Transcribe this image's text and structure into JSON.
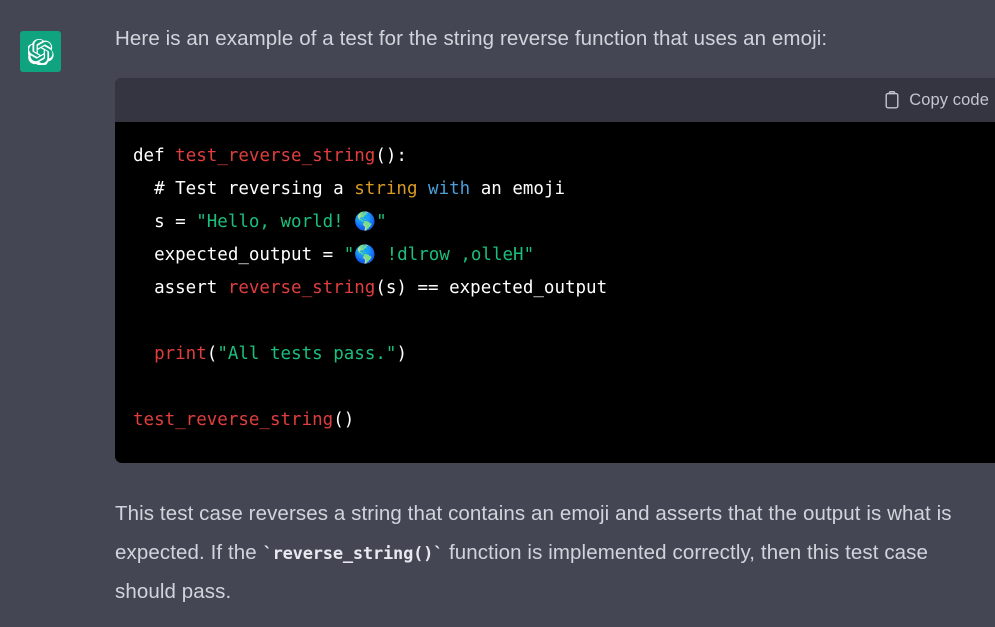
{
  "theme": {
    "page_background": "#444654",
    "avatar_background": "#10a37f",
    "code_header_background": "#343541",
    "code_body_background": "#000000",
    "text_color": "#d1d5db"
  },
  "avatar": {
    "icon": "openai-logo-icon",
    "alt": "ChatGPT"
  },
  "message": {
    "intro": "Here is an example of a test for the string reverse function that uses an emoji:",
    "outro_part1": "This test case reverses a string that contains an emoji and asserts that the output is what is expected. If the ",
    "outro_code": "`reverse_string()`",
    "outro_part2": " function is implemented correctly, then this test case should pass."
  },
  "code_block": {
    "language": "python",
    "copy_label": "Copy code",
    "copy_icon": "clipboard-icon",
    "lines": [
      {
        "id": "line-1",
        "tokens": [
          {
            "t": "def ",
            "c": "plain"
          },
          {
            "t": "test_reverse_string",
            "c": "fn"
          },
          {
            "t": "():",
            "c": "plain"
          }
        ]
      },
      {
        "id": "line-2",
        "tokens": [
          {
            "t": "  # Test reversing a ",
            "c": "comment"
          },
          {
            "t": "string",
            "c": "type"
          },
          {
            "t": " ",
            "c": "comment"
          },
          {
            "t": "with",
            "c": "kw"
          },
          {
            "t": " an emoji",
            "c": "comment"
          }
        ]
      },
      {
        "id": "line-3",
        "tokens": [
          {
            "t": "  s = ",
            "c": "plain"
          },
          {
            "t": "\"Hello, world! ",
            "c": "str"
          },
          {
            "t": "🌎",
            "c": "emoji"
          },
          {
            "t": "\"",
            "c": "str"
          }
        ]
      },
      {
        "id": "line-4",
        "tokens": [
          {
            "t": "  expected_output = ",
            "c": "plain"
          },
          {
            "t": "\"",
            "c": "str"
          },
          {
            "t": "🌎",
            "c": "emoji"
          },
          {
            "t": " !dlrow ,olleH\"",
            "c": "str"
          }
        ]
      },
      {
        "id": "line-5",
        "tokens": [
          {
            "t": "  assert ",
            "c": "plain"
          },
          {
            "t": "reverse_string",
            "c": "fn"
          },
          {
            "t": "(s) == expected_output",
            "c": "plain"
          }
        ]
      },
      {
        "id": "line-6",
        "tokens": []
      },
      {
        "id": "line-7",
        "tokens": [
          {
            "t": "  ",
            "c": "plain"
          },
          {
            "t": "print",
            "c": "fn"
          },
          {
            "t": "(",
            "c": "plain"
          },
          {
            "t": "\"All tests pass.\"",
            "c": "str"
          },
          {
            "t": ")",
            "c": "plain"
          }
        ]
      },
      {
        "id": "line-8",
        "tokens": []
      },
      {
        "id": "line-9",
        "tokens": [
          {
            "t": "test_reverse_string",
            "c": "fn"
          },
          {
            "t": "()",
            "c": "plain"
          }
        ]
      }
    ]
  }
}
